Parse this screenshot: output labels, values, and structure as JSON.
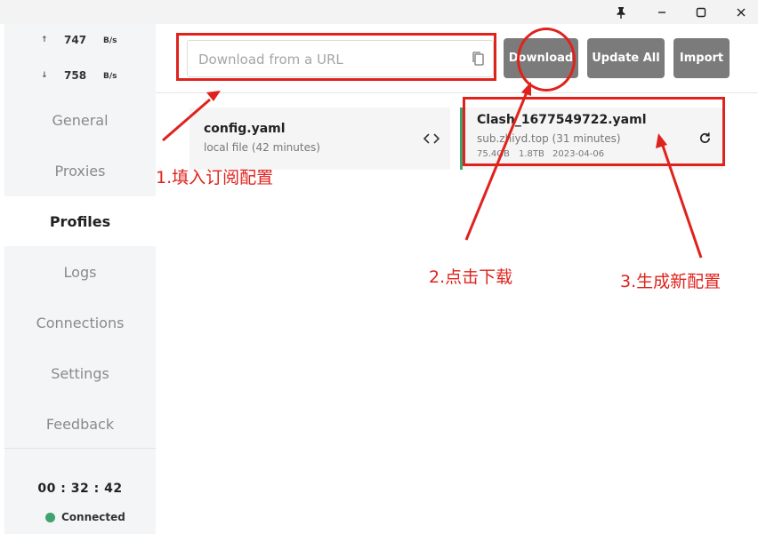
{
  "window": {
    "pin_icon": "pin-icon",
    "minimize_icon": "minimize-icon",
    "maximize_icon": "maximize-icon",
    "close_icon": "close-icon"
  },
  "traffic": {
    "up": {
      "arrow": "↑",
      "value": "747",
      "unit": "B/s"
    },
    "down": {
      "arrow": "↓",
      "value": "758",
      "unit": "B/s"
    }
  },
  "nav": [
    {
      "label": "General"
    },
    {
      "label": "Proxies"
    },
    {
      "label": "Profiles",
      "active": true
    },
    {
      "label": "Logs"
    },
    {
      "label": "Connections"
    },
    {
      "label": "Settings"
    },
    {
      "label": "Feedback"
    }
  ],
  "status": {
    "time": "00 : 32 : 42",
    "connection": "Connected",
    "connection_color": "#3fa36f"
  },
  "toolbar": {
    "url_placeholder": "Download from a URL",
    "download_label": "Download",
    "update_all_label": "Update All",
    "import_label": "Import"
  },
  "profiles": [
    {
      "name": "config.yaml",
      "source": "local file (42 minutes)",
      "icon": "code-icon",
      "active": false
    },
    {
      "name": "Clash_1677549722.yaml",
      "source": "sub.zhiyd.top (31 minutes)",
      "upload": "75.4GB",
      "total": "1.8TB",
      "expire": "2023-04-06",
      "icon": "refresh-icon",
      "active": true,
      "accent": "#3fa36f"
    }
  ],
  "annotations": {
    "step1": "1.填入订阅配置",
    "step2": "2.点击下载",
    "step3": "3.生成新配置",
    "color": "#e0221c"
  }
}
